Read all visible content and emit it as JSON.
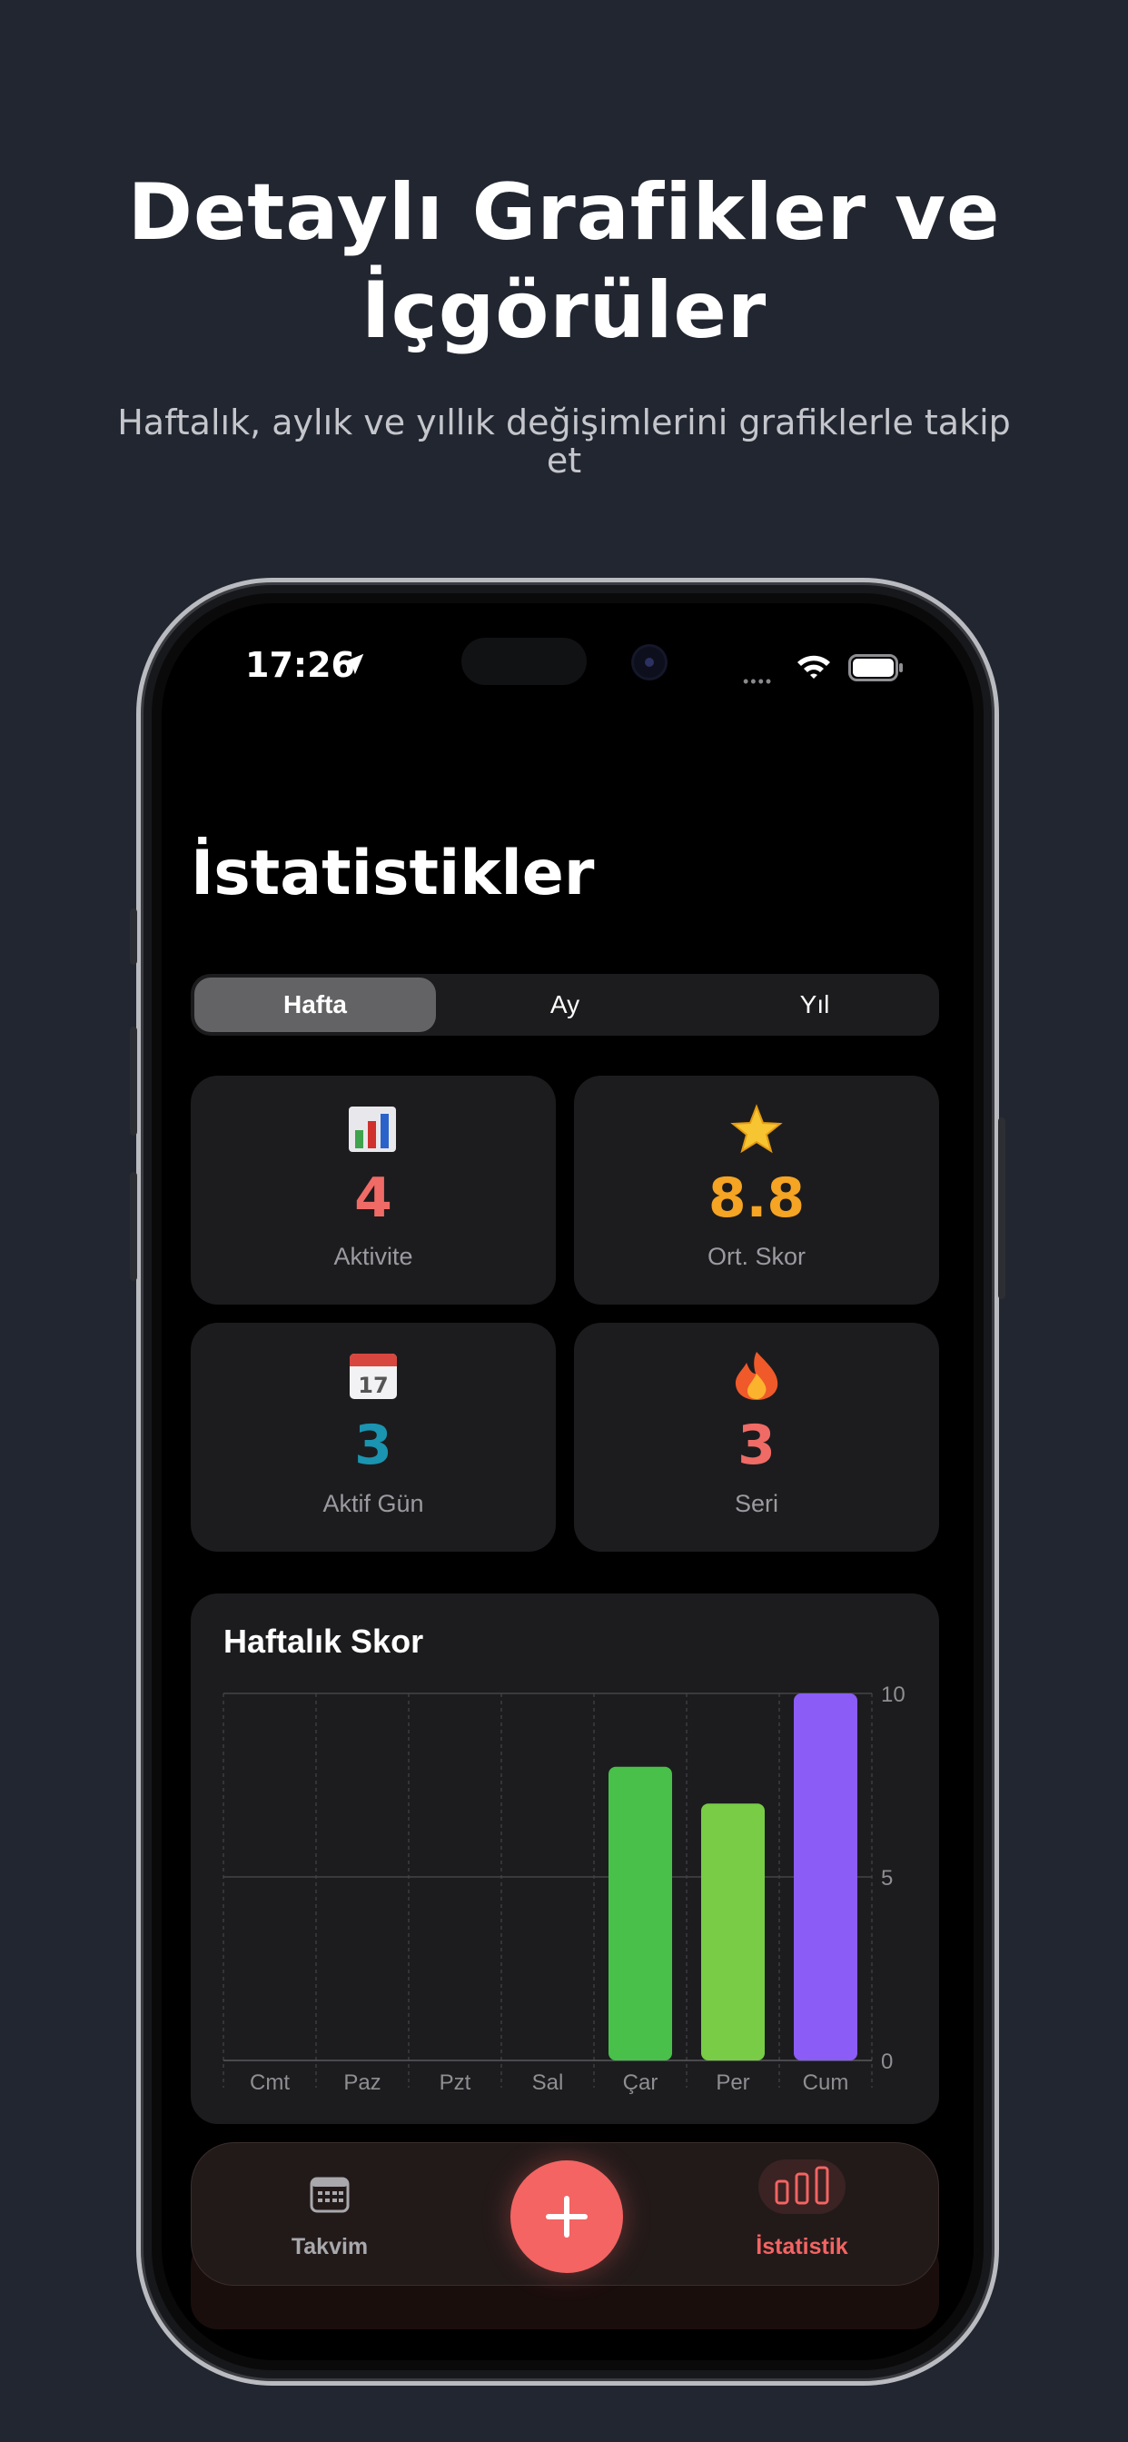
{
  "marketing": {
    "headline_line1": "Detaylı Grafikler ve",
    "headline_line2": "İçgörüler",
    "subtitle": "Haftalık, aylık ve yıllık değişimlerini grafiklerle takip et"
  },
  "status_bar": {
    "time": "17:26"
  },
  "screen": {
    "title": "İstatistikler",
    "segments": [
      {
        "label": "Hafta",
        "selected": true
      },
      {
        "label": "Ay",
        "selected": false
      },
      {
        "label": "Yıl",
        "selected": false
      }
    ],
    "stats": [
      {
        "icon": "bar-chart-emoji",
        "emoji": "📊",
        "value": "4",
        "label": "Aktivite",
        "color": "#f06b66"
      },
      {
        "icon": "star-emoji",
        "emoji": "⭐",
        "value": "8.8",
        "label": "Ort. Skor",
        "color": "#f5a423"
      },
      {
        "icon": "calendar-emoji",
        "emoji": "📅",
        "value": "3",
        "label": "Aktif Gün",
        "color": "#1a94b0"
      },
      {
        "icon": "fire-emoji",
        "emoji": "🔥",
        "value": "3",
        "label": "Seri",
        "color": "#f06b66"
      }
    ]
  },
  "chart_data": {
    "type": "bar",
    "title": "Haftalık Skor",
    "categories": [
      "Cmt",
      "Paz",
      "Pzt",
      "Sal",
      "Çar",
      "Per",
      "Cum"
    ],
    "values": [
      0,
      0,
      0,
      0,
      8,
      7,
      10
    ],
    "colors": [
      "#4cbb4b",
      "#4cbb4b",
      "#4cbb4b",
      "#4cbb4b",
      "#48c04a",
      "#78cc46",
      "#8b5cf6"
    ],
    "ylim": [
      0,
      10
    ],
    "yticks": [
      0,
      5,
      10
    ],
    "xlabel": "",
    "ylabel": "",
    "grid": true
  },
  "tabbar": {
    "items": [
      {
        "label": "Takvim",
        "icon": "calendar-icon",
        "selected": false,
        "color": "#a8a8ad"
      },
      {
        "label": "İstatistik",
        "icon": "bar-chart-icon",
        "selected": true,
        "color": "#f36463"
      }
    ],
    "fab_icon": "plus-icon",
    "accent": "#f36463"
  }
}
